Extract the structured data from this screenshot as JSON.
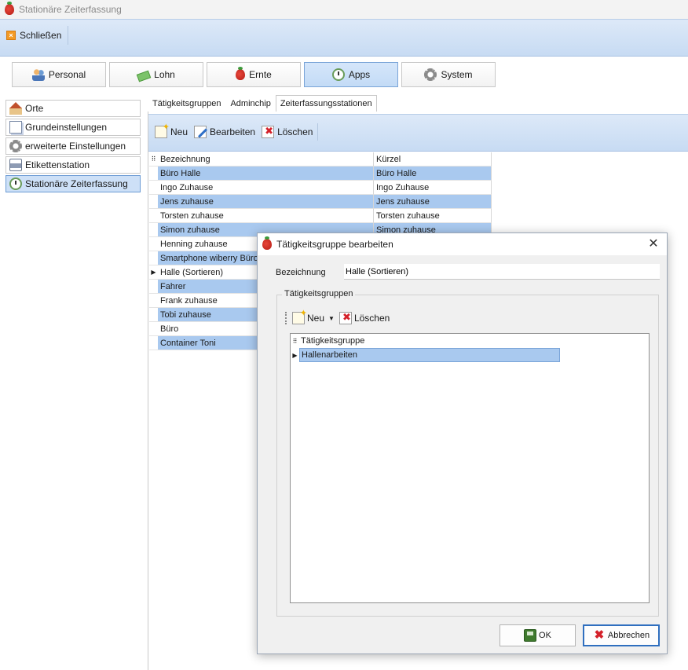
{
  "window": {
    "title": "Stationäre Zeiterfassung"
  },
  "toolbar": {
    "close_label": "Schließen"
  },
  "main_tabs": [
    {
      "label": "Personal",
      "icon": "people-icon"
    },
    {
      "label": "Lohn",
      "icon": "money-icon"
    },
    {
      "label": "Ernte",
      "icon": "strawberry-icon"
    },
    {
      "label": "Apps",
      "icon": "clock-icon",
      "active": true
    },
    {
      "label": "System",
      "icon": "gear-icon"
    }
  ],
  "sidebar": {
    "items": [
      {
        "label": "Orte",
        "icon": "home-icon"
      },
      {
        "label": "Grundeinstellungen",
        "icon": "pages-icon"
      },
      {
        "label": "erweiterte Einstellungen",
        "icon": "gear-icon"
      },
      {
        "label": "Etikettenstation",
        "icon": "printer-icon"
      },
      {
        "label": "Stationäre Zeiterfassung",
        "icon": "clock-icon",
        "active": true
      }
    ]
  },
  "sub_tabs": [
    {
      "label": "Tätigkeitsgruppen"
    },
    {
      "label": "Adminchip"
    },
    {
      "label": "Zeiterfassungsstationen",
      "active": true
    }
  ],
  "content_toolbar": {
    "new_label": "Neu",
    "edit_label": "Bearbeiten",
    "delete_label": "Löschen"
  },
  "grid": {
    "columns": [
      "Bezeichnung",
      "Kürzel"
    ],
    "rows": [
      {
        "name": "Büro Halle",
        "short": "Büro Halle",
        "selected": true
      },
      {
        "name": "Ingo Zuhause",
        "short": "Ingo Zuhause"
      },
      {
        "name": "Jens zuhause",
        "short": "Jens zuhause",
        "selected": true
      },
      {
        "name": "Torsten zuhause",
        "short": "Torsten zuhause"
      },
      {
        "name": "Simon zuhause",
        "short": "Simon zuhause",
        "selected": true
      },
      {
        "name": "Henning zuhause",
        "short": ""
      },
      {
        "name": "Smartphone wiberry Büro",
        "short": "",
        "selected": true
      },
      {
        "name": "Halle (Sortieren)",
        "short": "",
        "current": true
      },
      {
        "name": "Fahrer",
        "short": "",
        "selected": true
      },
      {
        "name": "Frank zuhause",
        "short": ""
      },
      {
        "name": "Tobi zuhause",
        "short": "",
        "selected": true
      },
      {
        "name": "Büro",
        "short": ""
      },
      {
        "name": "Container Toni",
        "short": "",
        "selected": true
      }
    ]
  },
  "dialog": {
    "title": "Tätigkeitsgruppe bearbeiten",
    "field_label": "Bezeichnung",
    "field_value": "Halle (Sortieren)",
    "group_title": "Tätigkeitsgruppen",
    "new_label": "Neu",
    "delete_label": "Löschen",
    "grid_header": "Tätigkeitsgruppe",
    "rows": [
      {
        "label": "Hallenarbeiten",
        "selected": true,
        "current": true
      }
    ],
    "ok_label": "OK",
    "cancel_label": "Abbrechen"
  }
}
